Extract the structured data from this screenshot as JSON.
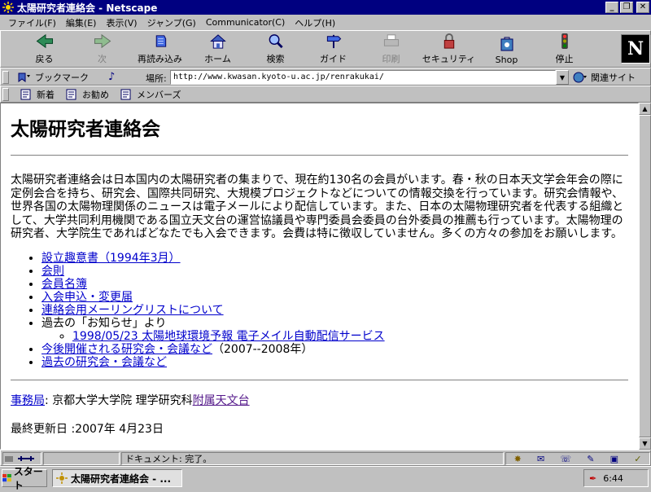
{
  "window": {
    "title": "太陽研究者連絡会 - Netscape"
  },
  "menu": [
    "ファイル(F)",
    "編集(E)",
    "表示(V)",
    "ジャンプ(G)",
    "Communicator(C)",
    "ヘルプ(H)"
  ],
  "toolbar": {
    "back": "戻る",
    "forward": "次",
    "reload": "再読み込み",
    "home": "ホーム",
    "search": "検索",
    "guide": "ガイド",
    "print": "印刷",
    "security": "セキュリティ",
    "shop": "Shop",
    "stop": "停止"
  },
  "location": {
    "bookmarks": "ブックマーク",
    "label": "場所:",
    "url": "http://www.kwasan.kyoto-u.ac.jp/renrakukai/",
    "related": "関連サイト"
  },
  "personal": {
    "new": "新着",
    "recommend": "お勧め",
    "members": "メンバーズ"
  },
  "page": {
    "heading": "太陽研究者連絡会",
    "intro": "太陽研究者連絡会は日本国内の太陽研究者の集まりで、現在約130名の会員がいます。春・秋の日本天文学会年会の際に定例会合を持ち、研究会、国際共同研究、大規模プロジェクトなどについての情報交換を行っています。研究会情報や、世界各国の太陽物理関係のニュースは電子メールにより配信しています。また、日本の太陽物理研究者を代表する組織として、大学共同利用機関である国立天文台の運営協議員や専門委員会委員の台外委員の推薦も行っています。太陽物理の研究者、大学院生であればどなたでも入会できます。会費は特に徴収していません。多くの方々の参加をお願いします。",
    "links": {
      "prospectus": "設立趣意書（1994年3月）",
      "rules": "会則",
      "roster": "会員名簿",
      "join": "入会申込・変更届",
      "mailing": "連絡会用メーリングリストについて",
      "notices": "過去の「お知らせ」より",
      "notice_item": "1998/05/23 太陽地球環境予報 電子メイル自動配信サービス",
      "upcoming": "今後開催される研究会・会議など",
      "upcoming_note": "（2007--2008年）",
      "past": "過去の研究会・会議など"
    },
    "office_link": "事務局",
    "office_text": ": 京都大学大学院 理学研究科",
    "observatory_link": "附属天文台",
    "updated": "最終更新日 :2007年 4月23日"
  },
  "status": {
    "text": "ドキュメント: 完了。"
  },
  "taskbar": {
    "start": "スタート",
    "task": "太陽研究者連絡会 - ...",
    "clock": "6:44"
  }
}
